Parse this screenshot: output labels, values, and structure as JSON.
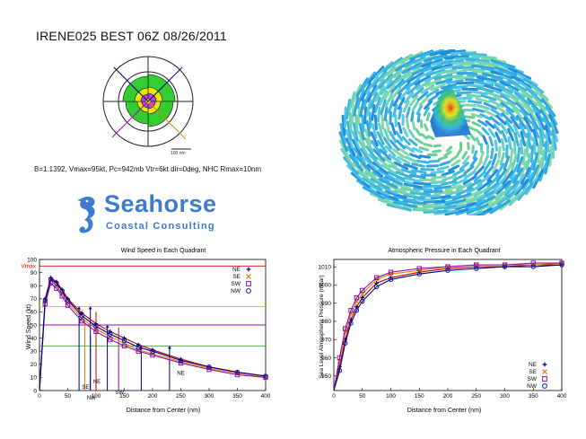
{
  "header": {
    "title": "IRENE025 BEST 06Z 08/26/2011",
    "params": "B=1.1392, Vmax=95kt, Pc=942mb Vtr=6kt dir=0deg, NHC Rmax=10nm"
  },
  "rose": {
    "scale_label": "100 nm"
  },
  "logo": {
    "main": "Seahorse",
    "sub": "Coastal Consulting"
  },
  "colors": {
    "NE": "#000080",
    "SE": "#e08000",
    "SW": "#9010b0",
    "NW": "#000080",
    "vmax": "#e00000"
  },
  "chart_data": [
    {
      "type": "line",
      "title": "Wind Speed in Each Quadrant",
      "xlabel": "Distance from Center (nm)",
      "ylabel": "Wind Speed (kt)",
      "xlim": [
        0,
        400
      ],
      "ylim": [
        0,
        100
      ],
      "xticks": [
        0,
        50,
        100,
        150,
        200,
        250,
        300,
        350,
        400
      ],
      "yticks": [
        0,
        10,
        20,
        30,
        40,
        50,
        60,
        70,
        80,
        90,
        100
      ],
      "legend": [
        "NE",
        "SE",
        "SW",
        "NW"
      ],
      "legend_position": "top-right",
      "vmax_label": "Vmax",
      "vmax": 95,
      "thresholds": [
        64,
        50,
        34
      ],
      "x": [
        0,
        10,
        20,
        30,
        40,
        50,
        75,
        100,
        125,
        150,
        175,
        200,
        250,
        300,
        350,
        400
      ],
      "series": [
        {
          "name": "NE",
          "values": [
            0,
            70,
            86,
            83,
            77,
            70,
            59,
            51,
            45,
            40,
            35,
            31,
            24,
            18,
            14,
            11
          ]
        },
        {
          "name": "SE",
          "values": [
            0,
            68,
            84,
            80,
            74,
            67,
            55,
            47,
            41,
            36,
            31,
            28,
            22,
            17,
            13,
            10
          ]
        },
        {
          "name": "SW",
          "values": [
            0,
            66,
            82,
            78,
            72,
            65,
            53,
            45,
            39,
            34,
            30,
            27,
            21,
            16,
            12,
            10
          ]
        },
        {
          "name": "NW",
          "values": [
            0,
            69,
            85,
            82,
            76,
            69,
            57,
            49,
            43,
            38,
            33,
            30,
            23,
            18,
            14,
            11
          ]
        }
      ],
      "radius_markers": [
        {
          "name": "NE",
          "label": "NE",
          "x": 100
        },
        {
          "name": "SE",
          "label": "SE",
          "x": 80
        },
        {
          "name": "SW",
          "label": "SW",
          "x": 140
        },
        {
          "name": "NW",
          "label": "NW",
          "x": 90
        }
      ],
      "extra_labels": [
        "NE"
      ]
    },
    {
      "type": "line",
      "title": "Atmospheric Pressure in Each Quadrant",
      "xlabel": "Distance from Center (nm)",
      "ylabel": "Sea Level Atmospheric Pressure (mbar)",
      "xlim": [
        0,
        400
      ],
      "ylim": [
        942,
        1014
      ],
      "xticks": [
        0,
        50,
        100,
        150,
        200,
        250,
        300,
        350,
        400
      ],
      "yticks": [
        950,
        960,
        970,
        980,
        990,
        1000,
        1010
      ],
      "legend": [
        "NE",
        "SE",
        "SW",
        "NW"
      ],
      "legend_position": "bottom-right",
      "x": [
        0,
        10,
        20,
        30,
        40,
        50,
        75,
        100,
        150,
        200,
        250,
        300,
        350,
        400
      ],
      "series": [
        {
          "name": "NE",
          "values": [
            942,
            955,
            970,
            981,
            988,
            993,
            1001,
            1004,
            1007,
            1009,
            1010,
            1010,
            1011,
            1011
          ]
        },
        {
          "name": "SE",
          "values": [
            942,
            958,
            974,
            984,
            991,
            995,
            1003,
            1006,
            1008,
            1010,
            1011,
            1011,
            1011,
            1012
          ]
        },
        {
          "name": "SW",
          "values": [
            942,
            960,
            976,
            986,
            993,
            997,
            1004,
            1007,
            1009,
            1010,
            1011,
            1011,
            1012,
            1012
          ]
        },
        {
          "name": "NW",
          "values": [
            942,
            953,
            968,
            979,
            986,
            991,
            999,
            1003,
            1006,
            1008,
            1009,
            1010,
            1010,
            1011
          ]
        }
      ]
    }
  ]
}
